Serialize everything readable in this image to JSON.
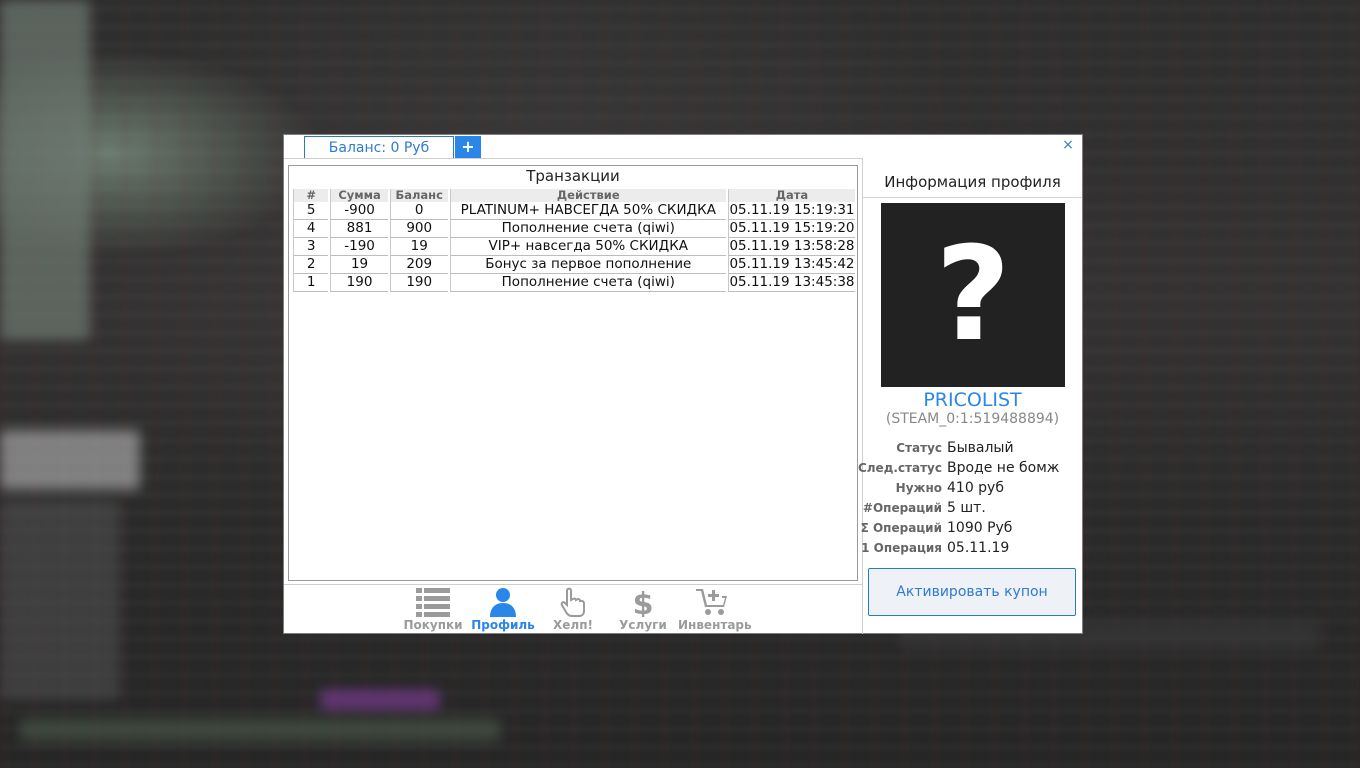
{
  "header": {
    "balance_tab": "Баланс: 0 Руб",
    "add_button": "+",
    "close_icon": "×"
  },
  "transactions": {
    "title": "Транзакции",
    "columns": [
      "#",
      "Сумма",
      "Баланс",
      "Действие",
      "Дата"
    ],
    "rows": [
      {
        "id": "5",
        "amount": "-900",
        "balance": "0",
        "action": "PLATINUM+ НАВСЕГДА 50% СКИДКА",
        "date": "05.11.19 15:19:31"
      },
      {
        "id": "4",
        "amount": "881",
        "balance": "900",
        "action": "Пополнение счета (qiwi)",
        "date": "05.11.19 15:19:20"
      },
      {
        "id": "3",
        "amount": "-190",
        "balance": "19",
        "action": "VIP+ навсегда 50% СКИДКА",
        "date": "05.11.19 13:58:28"
      },
      {
        "id": "2",
        "amount": "19",
        "balance": "209",
        "action": "Бонус за первое пополнение",
        "date": "05.11.19 13:45:42"
      },
      {
        "id": "1",
        "amount": "190",
        "balance": "190",
        "action": "Пополнение счета (qiwi)",
        "date": "05.11.19 13:45:38"
      }
    ]
  },
  "nav": {
    "items": [
      {
        "label": "Покупки",
        "icon": "list-icon",
        "active": false
      },
      {
        "label": "Профиль",
        "icon": "user-icon",
        "active": true
      },
      {
        "label": "Хелп!",
        "icon": "hand-pointer-icon",
        "active": false
      },
      {
        "label": "Услуги",
        "icon": "dollar-icon",
        "active": false
      },
      {
        "label": "Инвентарь",
        "icon": "cart-icon",
        "active": false
      }
    ]
  },
  "profile": {
    "title": "Информация профиля",
    "avatar_glyph": "?",
    "username": "PRICOLIST",
    "steam_id": "(STEAM_0:1:519488894)",
    "stats": [
      {
        "label": "Статус",
        "value": "Бывалый"
      },
      {
        "label": "След.статус",
        "value": "Вроде не бомж"
      },
      {
        "label": "Нужно",
        "value": "410 руб"
      },
      {
        "label": "#Операций",
        "value": "5 шт."
      },
      {
        "label": "Σ Операций",
        "value": "1090 Руб"
      },
      {
        "label": "1 Операция",
        "value": "05.11.19"
      }
    ],
    "coupon_button": "Активировать купон"
  },
  "colors": {
    "accent": "#2a86e8",
    "avatar_bg": "#222222",
    "inactive_nav": "#9b9b9b"
  }
}
